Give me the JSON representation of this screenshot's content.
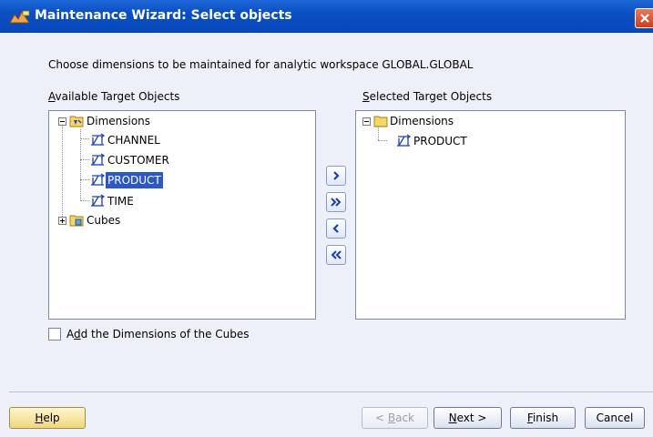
{
  "window": {
    "title": "Maintenance Wizard: Select objects"
  },
  "instruction": "Choose dimensions to be maintained for analytic workspace GLOBAL.GLOBAL",
  "available": {
    "label_accel": "A",
    "label_rest": "vailable Target Objects",
    "tree": {
      "root_label": "Dimensions",
      "children": [
        "CHANNEL",
        "CUSTOMER",
        "PRODUCT",
        "TIME"
      ],
      "selected": "PRODUCT",
      "second_root_label": "Cubes"
    }
  },
  "selected": {
    "label_accel": "S",
    "label_rest": "elected Target Objects",
    "tree": {
      "root_label": "Dimensions",
      "children": [
        "PRODUCT"
      ]
    }
  },
  "move_buttons": [
    "move-right",
    "move-all-right",
    "move-left",
    "move-all-left"
  ],
  "checkbox": {
    "prefix": "A",
    "accel": "d",
    "rest": "d the Dimensions of the Cubes",
    "checked": false
  },
  "buttons": {
    "help_accel": "H",
    "help_rest": "elp",
    "back_prefix": "< ",
    "back_accel": "B",
    "back_rest": "ack",
    "next_accel": "N",
    "next_rest": "ext >",
    "finish_accel": "F",
    "finish_rest": "inish",
    "cancel": "Cancel"
  },
  "colors": {
    "titlebar": "#0a4fc4",
    "selection": "#2b58c4",
    "help_button": "#f0d77b"
  }
}
